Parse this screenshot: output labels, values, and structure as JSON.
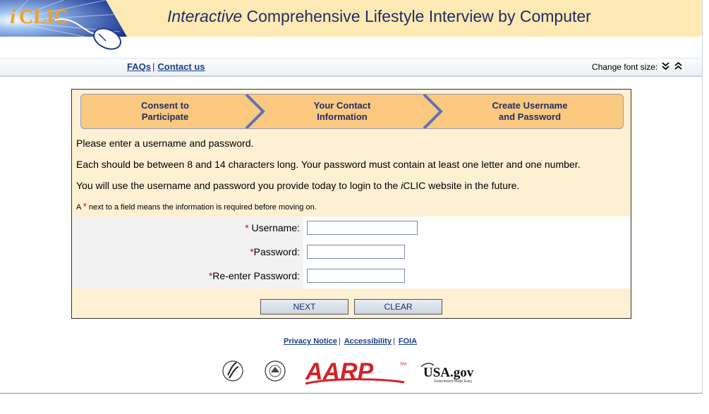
{
  "header": {
    "logo_text": "iCLIC",
    "title_em": "Interactive",
    "title_rest": " Comprehensive Lifestyle Interview by Computer"
  },
  "nav": {
    "faqs": "FAQs",
    "separator": "|",
    "contact": "Contact us",
    "font_size_label": "Change font size:",
    "decrease_icon": "double-chevron-down",
    "increase_icon": "double-chevron-up"
  },
  "steps": [
    {
      "line1": "Consent to",
      "line2": "Participate"
    },
    {
      "line1": "Your Contact",
      "line2": "Information"
    },
    {
      "line1": "Create Username",
      "line2": "and Password"
    }
  ],
  "messages": {
    "intro": "Please enter a username and password.",
    "length_rule": "Each should be between 8 and 14 characters long. Your password must contain at least one letter and one number.",
    "usage_pre": "You will use the username and password you provide today to login to the ",
    "usage_brand": "i",
    "usage_brand_rest": "CLIC",
    "usage_post": " website in the future.",
    "required_note_pre": "A ",
    "required_star": "*",
    "required_note_post": " next to a field means the information is required before moving on."
  },
  "form": {
    "username_label": " Username:",
    "password_label": "Password:",
    "reenter_label": "Re-enter Password:",
    "username_value": "",
    "password_value": "",
    "reenter_value": ""
  },
  "buttons": {
    "next": "NEXT",
    "clear": "CLEAR"
  },
  "footer": {
    "privacy": "Privacy Notice",
    "accessibility": "Accessibility",
    "foia": "FOIA",
    "separator": "|",
    "logos": [
      "HHS",
      "National Institutes of Health",
      "AARP",
      "USA.gov"
    ],
    "aarp_text": "AARP",
    "usagov_text": "USA.gov",
    "usagov_tag": "Government Made Easy"
  },
  "colors": {
    "header_bg": "#fde9b4",
    "panel_bg": "#fef0d3",
    "step_bg": "#fbc87f",
    "link": "#1a3f8a",
    "aarp_red": "#d2232a",
    "title_navy": "#1f2f63"
  }
}
